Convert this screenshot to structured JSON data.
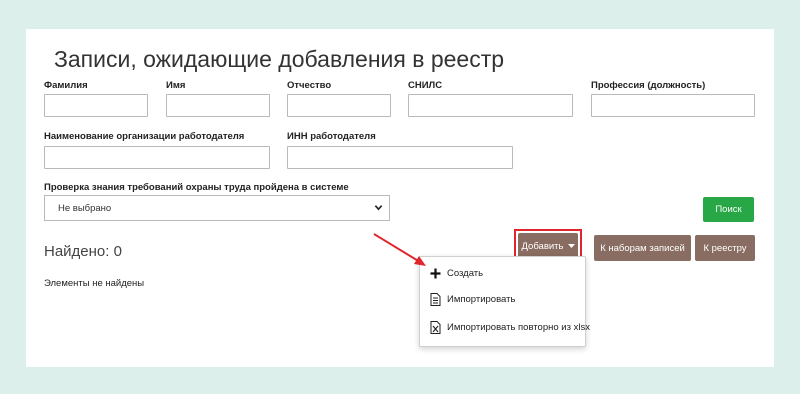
{
  "page": {
    "title": "Записи, ожидающие добавления в реестр"
  },
  "filters": {
    "last_name_label": "Фамилия",
    "first_name_label": "Имя",
    "patronymic_label": "Отчество",
    "snils_label": "СНИЛС",
    "profession_label": "Профессия (должность)",
    "employer_name_label": "Наименование организации работодателя",
    "employer_inn_label": "ИНН работодателя",
    "check_label": "Проверка знания требований охраны труда пройдена в системе",
    "check_value": "Не выбрано"
  },
  "actions": {
    "search_label": "Поиск",
    "add_label": "Добавить",
    "to_sets_label": "К наборам записей",
    "to_registry_label": "К реестру"
  },
  "results": {
    "found_text": "Найдено: 0",
    "empty_text": "Элементы не найдены"
  },
  "add_menu": {
    "items": [
      {
        "label": "Создать",
        "icon": "plus-icon"
      },
      {
        "label": "Импортировать",
        "icon": "document-icon"
      },
      {
        "label": "Импортировать повторно из xlsx",
        "icon": "excel-file-icon"
      }
    ]
  },
  "colors": {
    "background": "#dcefeb",
    "search_button": "#27a745",
    "action_buttons": "#8a6d62",
    "highlight": "#e0262b"
  }
}
